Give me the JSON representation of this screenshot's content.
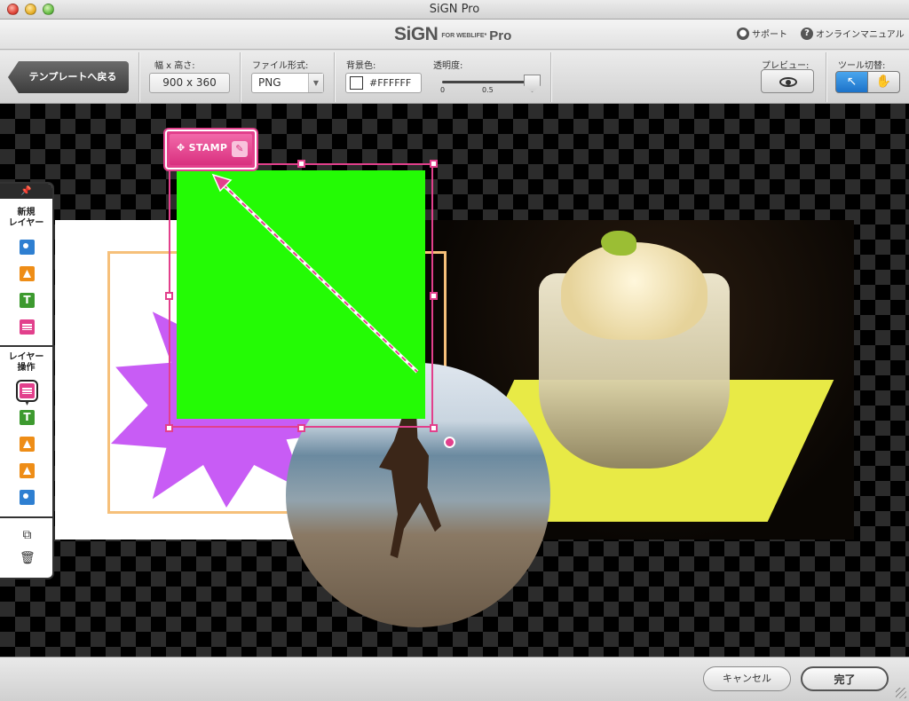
{
  "window": {
    "title": "SiGN Pro"
  },
  "header": {
    "logo_main": "SiGN",
    "logo_sub": "FOR WEBLIFE*",
    "logo_pro": "Pro",
    "support_label": "サポート",
    "manual_label": "オンラインマニュアル"
  },
  "toolbar": {
    "back_label": "テンプレートへ戻る",
    "size_label": "幅 x 高さ:",
    "size_value": "900 x 360",
    "format_label": "ファイル形式:",
    "format_value": "PNG",
    "bg_label": "背景色:",
    "bg_value": "#FFFFFF",
    "opacity_label": "透明度:",
    "opacity_value": 1.0,
    "opacity_tick_min": "0",
    "opacity_tick_mid": "0.5",
    "preview_label": "プレビュー:",
    "tool_label": "ツール切替:",
    "tool_arrow_icon": "↖",
    "tool_hand_icon": "✋"
  },
  "canvas": {
    "stamp_label": "✥ STAMP",
    "stamp_edit_icon": "✎"
  },
  "layer_panel": {
    "pin_icon": "📌",
    "new_layer_label_1": "新規",
    "new_layer_label_2": "レイヤー",
    "text_icon": "T",
    "layer_ops_label_1": "レイヤー",
    "layer_ops_label_2": "操作",
    "down_indicator": "▾",
    "duplicate_icon": "⧉",
    "delete_icon": "🗑"
  },
  "footer": {
    "cancel_label": "キャンセル",
    "done_label": "完了"
  },
  "colors": {
    "accent_pink": "#e2408c",
    "stamp_green": "#24fb05",
    "burst_purple": "#c85cf5",
    "frame_orange": "#f6c07a",
    "tool_active_blue": "#1c72c9"
  }
}
